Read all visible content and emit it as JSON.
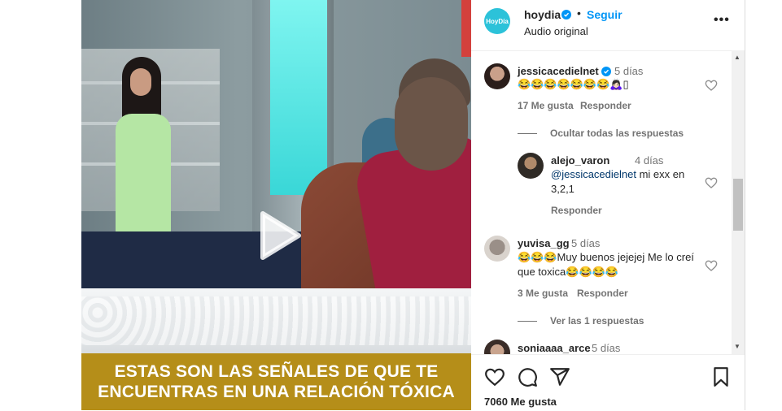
{
  "video": {
    "caption_line1": "ESTAS SON LAS SEÑALES DE QUE TE",
    "caption_line2": "ENCUENTRAS EN UNA RELACIÓN TÓXICA",
    "banner_color": "#b58e19"
  },
  "header": {
    "avatar_text": "HoyDía",
    "username": "hoydia",
    "separator": "•",
    "follow_label": "Seguir",
    "audio_label": "Audio original",
    "more_label": "•••"
  },
  "comments": [
    {
      "username": "jessicacedielnet",
      "time": "5 días",
      "text": "😂😂😂😂😂😂😂🙇🏻‍♀️▯",
      "likes": "17 Me gusta",
      "reply_label": "Responder",
      "toggle_label": "Ocultar todas las respuestas"
    },
    {
      "username": "alejo_varon",
      "time": "4 días",
      "mention": "@jessicacedielnet",
      "text": " mi exx en 3,2,1",
      "reply_label": "Responder"
    },
    {
      "username": "yuvisa_gg",
      "time": "5 días",
      "text": "😂😂😂Muy buenos jejejej Me lo creí que toxica😂😂😂😂",
      "likes": "3 Me gusta",
      "reply_label": "Responder",
      "toggle_label": "Ver las 1 respuestas"
    },
    {
      "username": "soniaaaa_arce",
      "time": "5 días"
    }
  ],
  "footer": {
    "likes_count": "7060 Me gusta"
  },
  "colors": {
    "accent": "#0095f6",
    "text": "#262626",
    "muted": "#737373"
  }
}
